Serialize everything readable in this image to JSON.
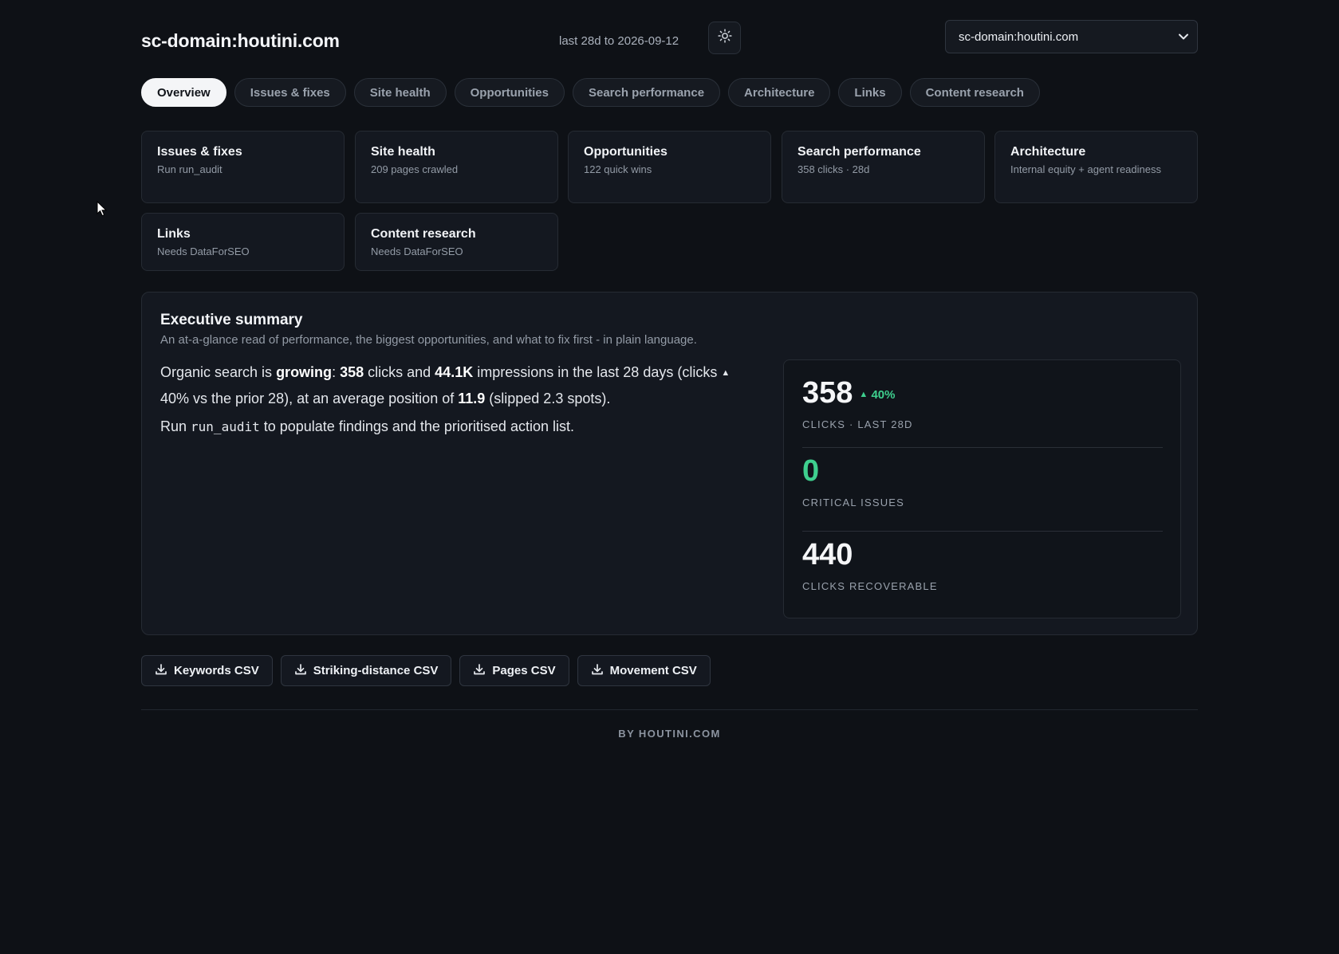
{
  "header": {
    "site_title": "sc-domain:houtini.com",
    "date_range": "last 28d to 2026-09-12",
    "selected_property": "sc-domain:houtini.com"
  },
  "tabs": [
    {
      "label": "Overview",
      "active": true
    },
    {
      "label": "Issues & fixes",
      "active": false
    },
    {
      "label": "Site health",
      "active": false
    },
    {
      "label": "Opportunities",
      "active": false
    },
    {
      "label": "Search performance",
      "active": false
    },
    {
      "label": "Architecture",
      "active": false
    },
    {
      "label": "Links",
      "active": false
    },
    {
      "label": "Content research",
      "active": false
    }
  ],
  "cards": [
    {
      "title": "Issues & fixes",
      "sub": "Run run_audit"
    },
    {
      "title": "Site health",
      "sub": "209 pages crawled"
    },
    {
      "title": "Opportunities",
      "sub": "122 quick wins"
    },
    {
      "title": "Search performance",
      "sub": "358 clicks · 28d"
    },
    {
      "title": "Architecture",
      "sub": "Internal equity + agent readiness"
    },
    {
      "title": "Links",
      "sub": "Needs DataForSEO"
    },
    {
      "title": "Content research",
      "sub": "Needs DataForSEO"
    }
  ],
  "summary": {
    "title": "Executive summary",
    "subtitle": "An at-a-glance read of performance, the biggest opportunities, and what to fix first - in plain language.",
    "text": {
      "p1": "Organic search is ",
      "trend": "growing",
      "p2": ": ",
      "clicks": "358",
      "p3": " clicks and ",
      "impressions": "44.1K",
      "p4": " impressions in the last 28 days (clicks ",
      "p5": " 40% vs the prior 28), at an average position of ",
      "position": "11.9",
      "p6": " (slipped 2.3 spots)."
    },
    "note": {
      "before": "Run ",
      "code": "run_audit",
      "after": " to populate findings and the prioritised action list."
    },
    "stats": [
      {
        "value": "358",
        "delta": "40%",
        "label": "Clicks · last 28d"
      },
      {
        "value": "0",
        "label": "Critical issues"
      },
      {
        "value": "440",
        "label": "Clicks recoverable"
      }
    ]
  },
  "csv_buttons": [
    {
      "label": "Keywords CSV"
    },
    {
      "label": "Striking-distance CSV"
    },
    {
      "label": "Pages CSV"
    },
    {
      "label": "Movement CSV"
    }
  ],
  "footer": "BY HOUTINI.COM",
  "colors": {
    "accent_green": "#3ecf8e",
    "background": "#0e1116",
    "card": "#141820"
  }
}
